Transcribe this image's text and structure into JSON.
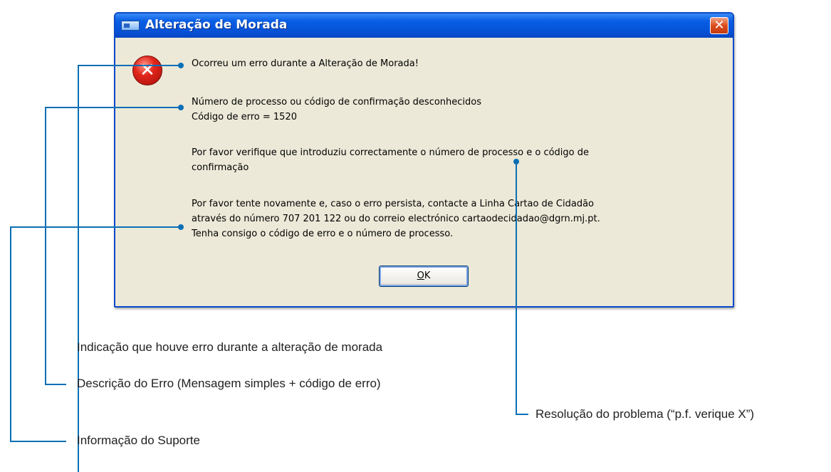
{
  "dialog": {
    "title": "Alteração de Morada",
    "close_symbol": "✕",
    "icon": "error-x-icon",
    "lines": [
      "Ocorreu um erro durante a Alteração de Morada!",
      "Número de processo ou código de confirmação desconhecidos",
      "Código de erro = 1520",
      "Por favor verifique que introduziu correctamente o número de processo e o código de",
      "confirmação",
      "Por favor tente novamente e, caso o erro persista, contacte a Linha Cartao de Cidadão",
      "através do número 707 201 122 ou do correio electrónico cartaodecidadao@dgrn.mj.pt.",
      "Tenha consigo o código de erro e o número de processo."
    ],
    "ok_label": "OK",
    "ok_mnemonic": "O",
    "ok_rest": "K"
  },
  "annotations": {
    "error_indication": "Indicação que houve erro durante a alteração de morada",
    "error_description": "Descrição do Erro (Mensagem simples + código de erro)",
    "resolution": "Resolução do problema (“p.f. verique X”)",
    "support_info": "Informação do Suporte"
  },
  "colors": {
    "callout_line": "#0b6fb5",
    "titlebar": "#0553d8",
    "dialog_bg": "#ece9d8"
  }
}
